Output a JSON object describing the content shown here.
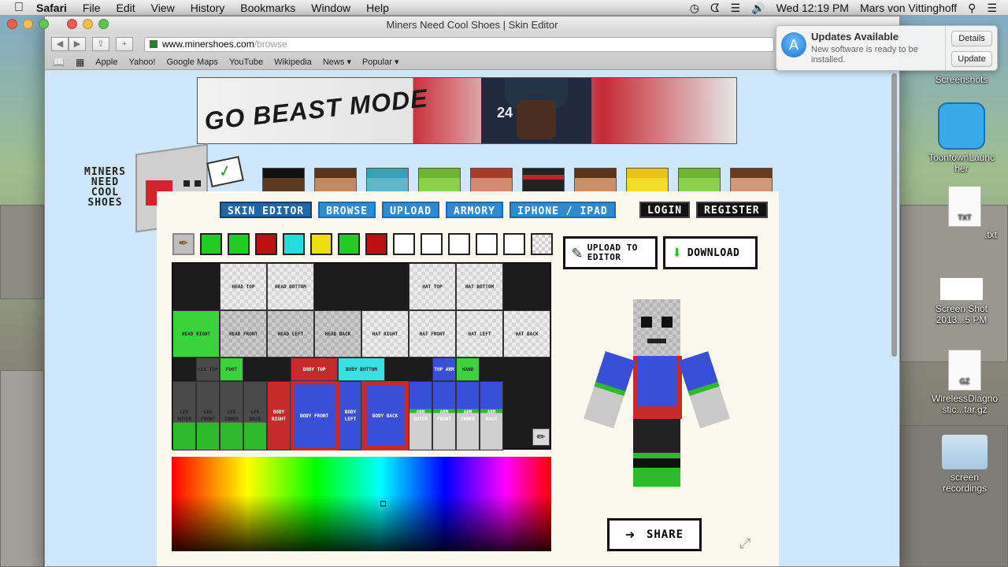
{
  "menubar": {
    "app": "Safari",
    "items": [
      "File",
      "Edit",
      "View",
      "History",
      "Bookmarks",
      "Window",
      "Help"
    ],
    "clock": "Wed 12:19 PM",
    "user": "Mars von Vittinghoff"
  },
  "window": {
    "title": "Miners Need Cool Shoes | Skin Editor",
    "url_host": "www.minershoes.com",
    "url_path": "/browse"
  },
  "bookmarks": [
    "Apple",
    "Yahoo!",
    "Google Maps",
    "YouTube",
    "Wikipedia",
    "News",
    "Popular"
  ],
  "banner": {
    "slogan": "GO BEAST MODE",
    "jersey_number": "24"
  },
  "logo": {
    "line1": "MINERS",
    "line2": "NEED",
    "line3": "COOL",
    "line4": "SHOES"
  },
  "tabs": [
    "SKIN EDITOR",
    "BROWSE",
    "UPLOAD",
    "ARMORY",
    "IPHONE / IPAD"
  ],
  "auth": {
    "login": "LOGIN",
    "register": "REGISTER"
  },
  "palette": {
    "colors": [
      "#22cc22",
      "#22cc22",
      "#bb1111",
      "#22dddd",
      "#eedd11",
      "#22cc22",
      "#bb1111",
      "#ffffff",
      "#ffffff",
      "#ffffff",
      "#ffffff",
      "#ffffff",
      "checker"
    ]
  },
  "skin_parts": {
    "head_top": "HEAD TOP",
    "head_bottom": "HEAD BOTTOM",
    "hat_top": "HAT TOP",
    "hat_bottom": "HAT BOTTOM",
    "head_right": "HEAD RIGHT",
    "head_front": "HEAD FRONT",
    "head_left": "HEAD LEFT",
    "head_back": "HEAD BACK",
    "hat_right": "HAT RIGHT",
    "hat_front": "HAT FRONT",
    "hat_left": "HAT LEFT",
    "hat_back": "HAT BACK",
    "leg_top": "LEG TOP",
    "foot": "FOOT",
    "body_top": "BODY TOP",
    "body_bottom": "BODY BOTTOM",
    "top_arm": "TOP ARM",
    "hand": "HAND",
    "leg_outer": "LEG OUTER",
    "leg_front": "LEG FRONT",
    "leg_inner": "LEG INNER",
    "leg_back": "LEG BACK",
    "body_right": "BODY RIGHT",
    "body_front": "BODY FRONT",
    "body_left": "BODY LEFT",
    "body_back": "BODY BACK",
    "arm_outer": "ARM OUTER",
    "arm_front": "ARM FRONT",
    "arm_inner": "ARM INNER",
    "arm_back": "ARM BACK"
  },
  "actions": {
    "upload": "UPLOAD TO EDITOR",
    "download": "DOWNLOAD",
    "share": "SHARE"
  },
  "notification": {
    "title": "Updates Available",
    "body": "New software is ready to be installed.",
    "details": "Details",
    "update": "Update"
  },
  "desktop": {
    "screenshots": "Screenshots",
    "toontown": "ToontownLauncher",
    "txt_badge": "TXT",
    "txt_file": ".txt",
    "screenshot_file": "Screen Shot 2013...5 PM",
    "gz_badge": "GZ",
    "gz_file": "WirelessDiagnostic...tar.gz",
    "recordings": "screen recordings"
  },
  "colors": {
    "tab_blue": "#2f8ad0",
    "accent_green": "#22cc22",
    "brand_red": "#d7222b"
  }
}
